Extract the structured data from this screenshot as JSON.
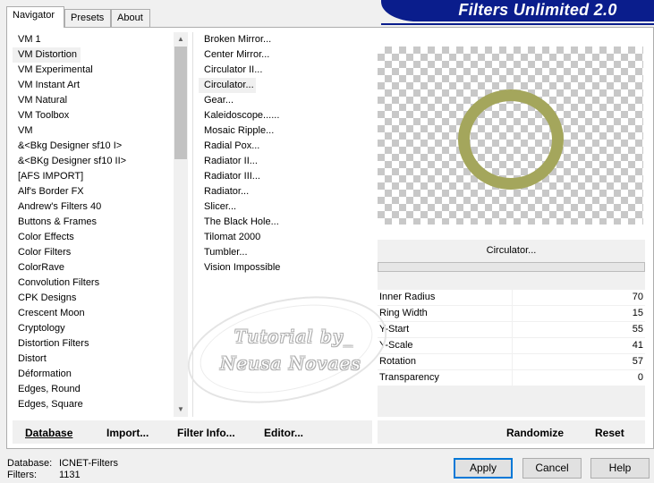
{
  "tabs": [
    {
      "label": "Navigator",
      "active": true
    },
    {
      "label": "Presets",
      "active": false
    },
    {
      "label": "About",
      "active": false
    }
  ],
  "app_title": "Filters Unlimited 2.0",
  "categories": [
    "VM 1",
    "VM Distortion",
    "VM Experimental",
    "VM Instant Art",
    "VM Natural",
    "VM Toolbox",
    "VM",
    "&<Bkg Designer sf10 I>",
    "&<BKg Designer sf10 II>",
    "[AFS IMPORT]",
    "Alf's Border FX",
    "Andrew's Filters 40",
    "Buttons & Frames",
    "Color Effects",
    "Color Filters",
    "ColorRave",
    "Convolution Filters",
    "CPK Designs",
    "Crescent Moon",
    "Cryptology",
    "Distortion Filters",
    "Distort",
    "Déformation",
    "Edges, Round",
    "Edges, Square"
  ],
  "selected_category": "VM Distortion",
  "filters": [
    "Broken Mirror...",
    "Center Mirror...",
    "Circulator II...",
    "Circulator...",
    "Gear...",
    "Kaleidoscope......",
    "Mosaic Ripple...",
    "Radial Pox...",
    "Radiator II...",
    "Radiator III...",
    "Radiator...",
    "Slicer...",
    "The Black Hole...",
    "Tilomat 2000",
    "Tumbler...",
    "Vision Impossible"
  ],
  "selected_filter": "Circulator...",
  "preview": {
    "ring_color": "#a4a65c"
  },
  "current_filter_name": "Circulator...",
  "params": [
    {
      "label": "Inner Radius",
      "value": "70"
    },
    {
      "label": "Ring Width",
      "value": "15"
    },
    {
      "label": "Y-Start",
      "value": "55"
    },
    {
      "label": "Y-Scale",
      "value": "41"
    },
    {
      "label": "Rotation",
      "value": "57"
    },
    {
      "label": "Transparency",
      "value": "0"
    }
  ],
  "bottom_buttons": {
    "database": "Database",
    "import": "Import...",
    "filter_info": "Filter Info...",
    "editor": "Editor...",
    "randomize": "Randomize",
    "reset": "Reset"
  },
  "status": {
    "database_label": "Database:",
    "database_value": "ICNET-Filters",
    "filters_label": "Filters:",
    "filters_value": "1131"
  },
  "dialog_buttons": {
    "apply": "Apply",
    "cancel": "Cancel",
    "help": "Help"
  },
  "watermark": {
    "line1": "Tutorial by_",
    "line2": "Neusa Novaes"
  },
  "colors": {
    "banner": "#0a1d8c",
    "default_button_border": "#0078d7"
  }
}
